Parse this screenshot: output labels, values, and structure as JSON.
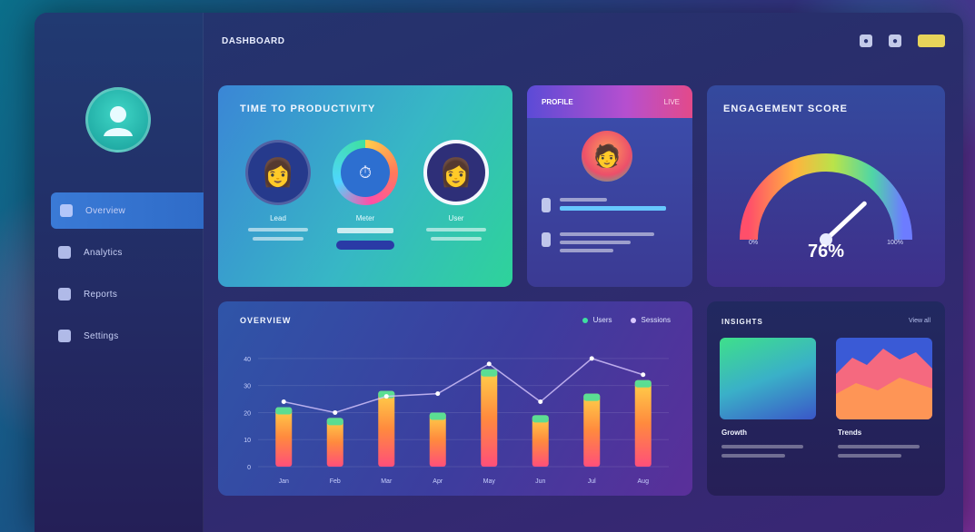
{
  "window": {
    "title": "DASHBOARD"
  },
  "sidebar": {
    "items": [
      {
        "label": "Overview",
        "icon": "file-icon",
        "active": true
      },
      {
        "label": "Analytics",
        "icon": "grid-icon",
        "active": false
      },
      {
        "label": "Reports",
        "icon": "chart-icon",
        "active": false
      },
      {
        "label": "Settings",
        "icon": "gear-icon",
        "active": false
      }
    ]
  },
  "topbar": {
    "icons": [
      "bell-icon",
      "user-icon"
    ],
    "accent": "#e7d45a"
  },
  "time_card": {
    "title": "TIME TO PRODUCTIVITY",
    "people": [
      {
        "name": "Lead",
        "emoji": "👩",
        "highlight": false
      },
      {
        "name": "Meter",
        "emoji": "⏱",
        "highlight": true
      },
      {
        "name": "User",
        "emoji": "👩",
        "highlight": false
      }
    ]
  },
  "profile_card": {
    "title": "PROFILE",
    "badge": "LIVE",
    "emoji": "🧑"
  },
  "engagement_card": {
    "title": "ENGAGEMENT SCORE",
    "value_text": "76%",
    "value": 76,
    "min": "0%",
    "max": "100%"
  },
  "chart_card": {
    "title": "OVERVIEW",
    "legend": [
      {
        "name": "Users",
        "color": "#3ee0a0"
      },
      {
        "name": "Sessions",
        "color": "#d9c8ff"
      }
    ]
  },
  "chart_data": {
    "type": "bar",
    "categories": [
      "Jan",
      "Feb",
      "Mar",
      "Apr",
      "May",
      "Jun",
      "Jul",
      "Aug"
    ],
    "series": [
      {
        "name": "Users",
        "values": [
          22,
          18,
          28,
          20,
          36,
          19,
          27,
          32
        ]
      },
      {
        "name": "Sessions",
        "values": [
          24,
          20,
          26,
          27,
          38,
          24,
          40,
          34
        ]
      }
    ],
    "yticks": [
      "0",
      "10",
      "20",
      "30",
      "40"
    ],
    "ylim": [
      0,
      45
    ]
  },
  "thumbs_card": {
    "title": "INSIGHTS",
    "view_all": "View all",
    "items": [
      {
        "label": "Growth"
      },
      {
        "label": "Trends"
      }
    ]
  }
}
